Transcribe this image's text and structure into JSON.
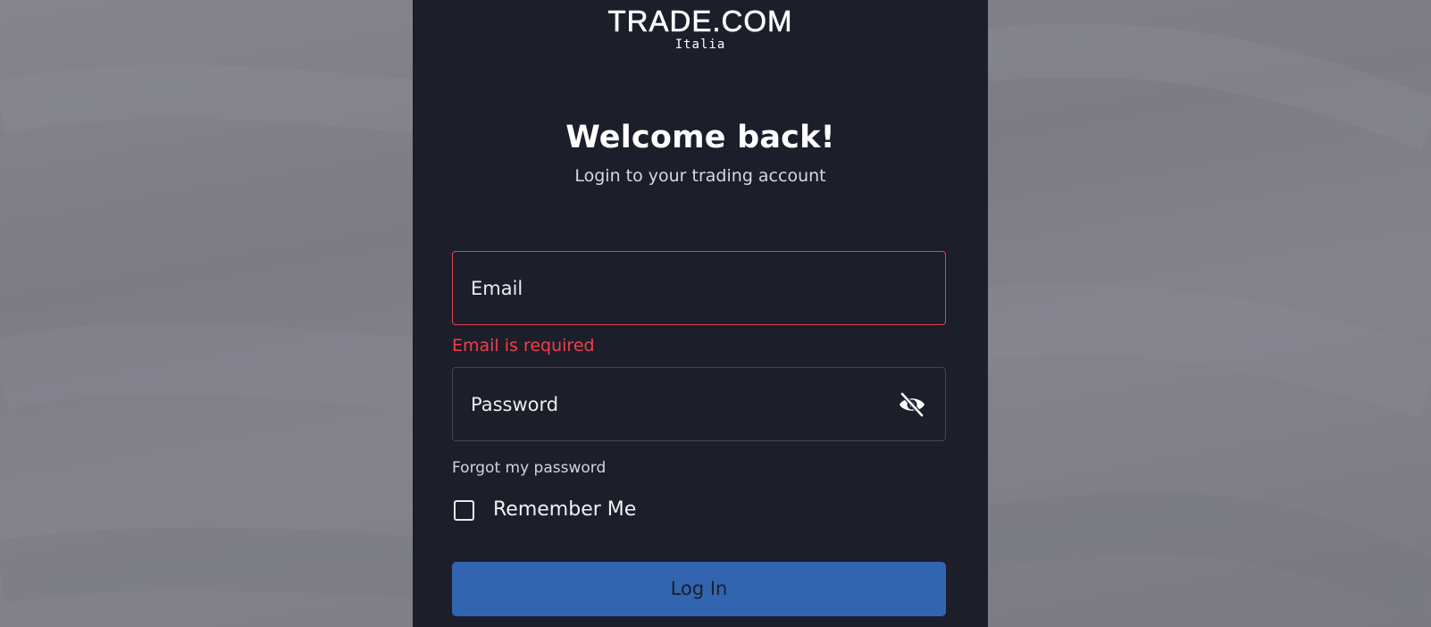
{
  "brand": {
    "logo_text": "TRADE.COM",
    "region": "Italia"
  },
  "login": {
    "title": "Welcome back!",
    "subtitle": "Login to your trading account",
    "email_label": "Email",
    "email_error": "Email is required",
    "password_label": "Password",
    "forgot_password": "Forgot my password",
    "remember_me": "Remember Me",
    "login_button": "Log In",
    "password_toggle_icon": "eye-off-icon"
  },
  "colors": {
    "panel_bg": "#1c1e2a",
    "error": "#f0404a",
    "primary_button": "#3265b0",
    "page_bg": "#82818a"
  }
}
